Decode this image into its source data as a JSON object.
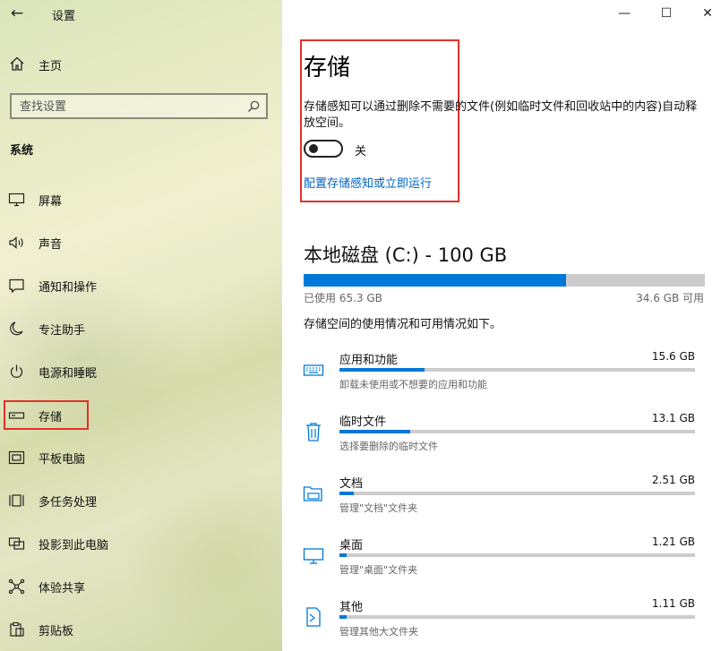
{
  "window": {
    "title": "设置",
    "minimize_glyph": "—",
    "maximize_glyph": "☐",
    "close_glyph": "✕"
  },
  "nav": {
    "back_glyph": "←",
    "home_label": "主页",
    "search_placeholder": "查找设置",
    "section_label": "系统",
    "items": [
      {
        "label": "屏幕",
        "icon": "monitor-icon"
      },
      {
        "label": "声音",
        "icon": "speaker-icon"
      },
      {
        "label": "通知和操作",
        "icon": "notification-icon"
      },
      {
        "label": "专注助手",
        "icon": "moon-icon"
      },
      {
        "label": "电源和睡眠",
        "icon": "power-icon"
      },
      {
        "label": "存储",
        "icon": "storage-icon",
        "selected": true
      },
      {
        "label": "平板电脑",
        "icon": "tablet-icon"
      },
      {
        "label": "多任务处理",
        "icon": "multitask-icon"
      },
      {
        "label": "投影到此电脑",
        "icon": "project-icon"
      },
      {
        "label": "体验共享",
        "icon": "share-icon"
      },
      {
        "label": "剪贴板",
        "icon": "clipboard-icon"
      }
    ]
  },
  "main": {
    "title": "存储",
    "storage_sense_desc": "存储感知可以通过删除不需要的文件(例如临时文件和回收站中的内容)自动释放空间。",
    "toggle_state": "关",
    "toggle_on": false,
    "config_link": "配置存储感知或立即运行",
    "disk": {
      "title": "本地磁盘 (C:) - 100 GB",
      "used_label": "已使用 65.3 GB",
      "available_label": "34.6 GB 可用",
      "used_fraction": 0.653,
      "usage_desc": "存储空间的使用情况和可用情况如下。"
    },
    "categories": [
      {
        "name": "应用和功能",
        "size": "15.6 GB",
        "desc": "卸载未使用或不想要的应用和功能",
        "fraction": 0.24,
        "icon": "keyboard-icon"
      },
      {
        "name": "临时文件",
        "size": "13.1 GB",
        "desc": "选择要删除的临时文件",
        "fraction": 0.2,
        "icon": "trash-icon"
      },
      {
        "name": "文档",
        "size": "2.51 GB",
        "desc": "管理\"文档\"文件夹",
        "fraction": 0.04,
        "icon": "folder-icon"
      },
      {
        "name": "桌面",
        "size": "1.21 GB",
        "desc": "管理\"桌面\"文件夹",
        "fraction": 0.02,
        "icon": "desktop-icon"
      },
      {
        "name": "其他",
        "size": "1.11 GB",
        "desc": "管理其他大文件夹",
        "fraction": 0.02,
        "icon": "other-icon"
      }
    ]
  },
  "colors": {
    "accent": "#0078d7",
    "link": "#0063c2",
    "highlight_border": "#e2312b",
    "bar_track": "#cccccc"
  }
}
